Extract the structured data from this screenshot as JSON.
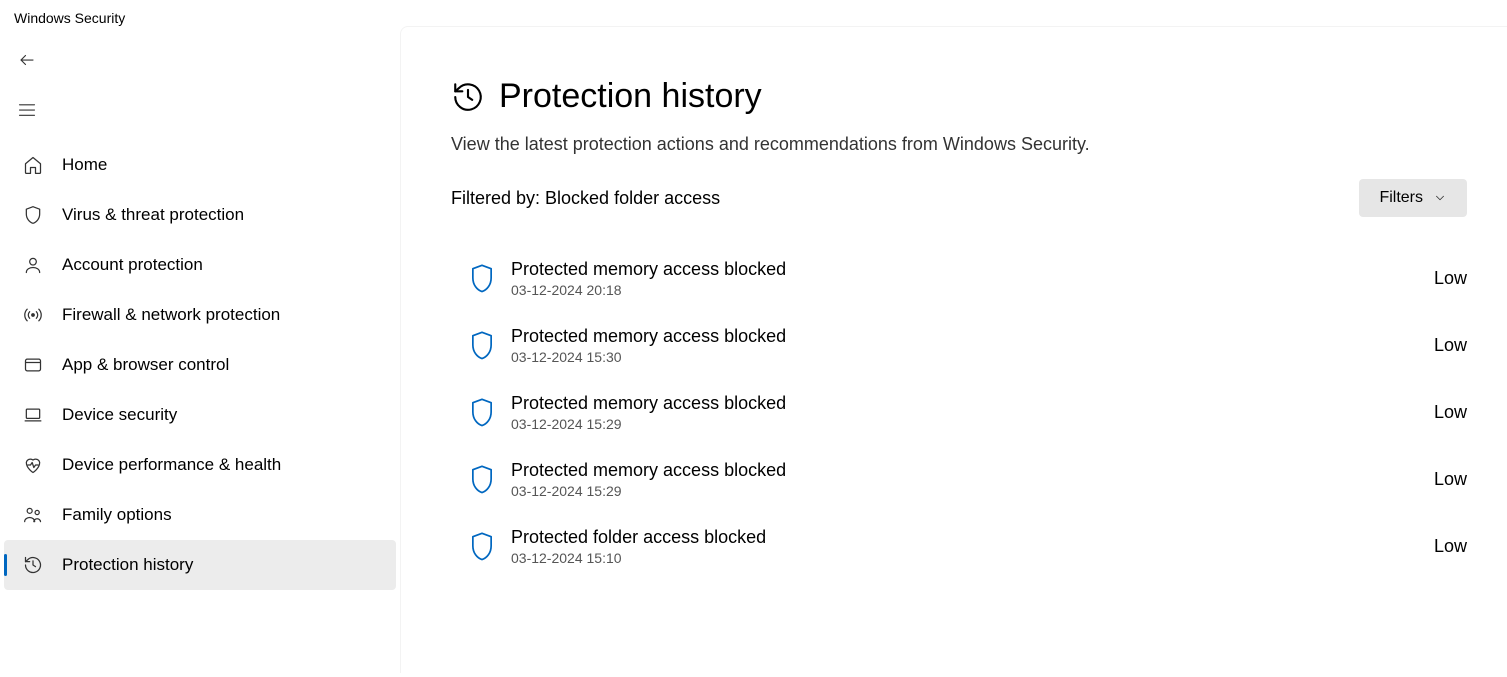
{
  "app_title": "Windows Security",
  "sidebar": {
    "items": [
      {
        "label": "Home"
      },
      {
        "label": "Virus & threat protection"
      },
      {
        "label": "Account protection"
      },
      {
        "label": "Firewall & network protection"
      },
      {
        "label": "App & browser control"
      },
      {
        "label": "Device security"
      },
      {
        "label": "Device performance & health"
      },
      {
        "label": "Family options"
      },
      {
        "label": "Protection history"
      }
    ]
  },
  "header": {
    "title": "Protection history",
    "subtitle": "View the latest protection actions and recommendations from Windows Security."
  },
  "filter": {
    "text": "Filtered by: Blocked folder access",
    "button_label": "Filters"
  },
  "history": [
    {
      "title": "Protected memory access blocked",
      "timestamp": "03-12-2024 20:18",
      "severity": "Low"
    },
    {
      "title": "Protected memory access blocked",
      "timestamp": "03-12-2024 15:30",
      "severity": "Low"
    },
    {
      "title": "Protected memory access blocked",
      "timestamp": "03-12-2024 15:29",
      "severity": "Low"
    },
    {
      "title": "Protected memory access blocked",
      "timestamp": "03-12-2024 15:29",
      "severity": "Low"
    },
    {
      "title": "Protected folder access blocked",
      "timestamp": "03-12-2024 15:10",
      "severity": "Low"
    }
  ]
}
